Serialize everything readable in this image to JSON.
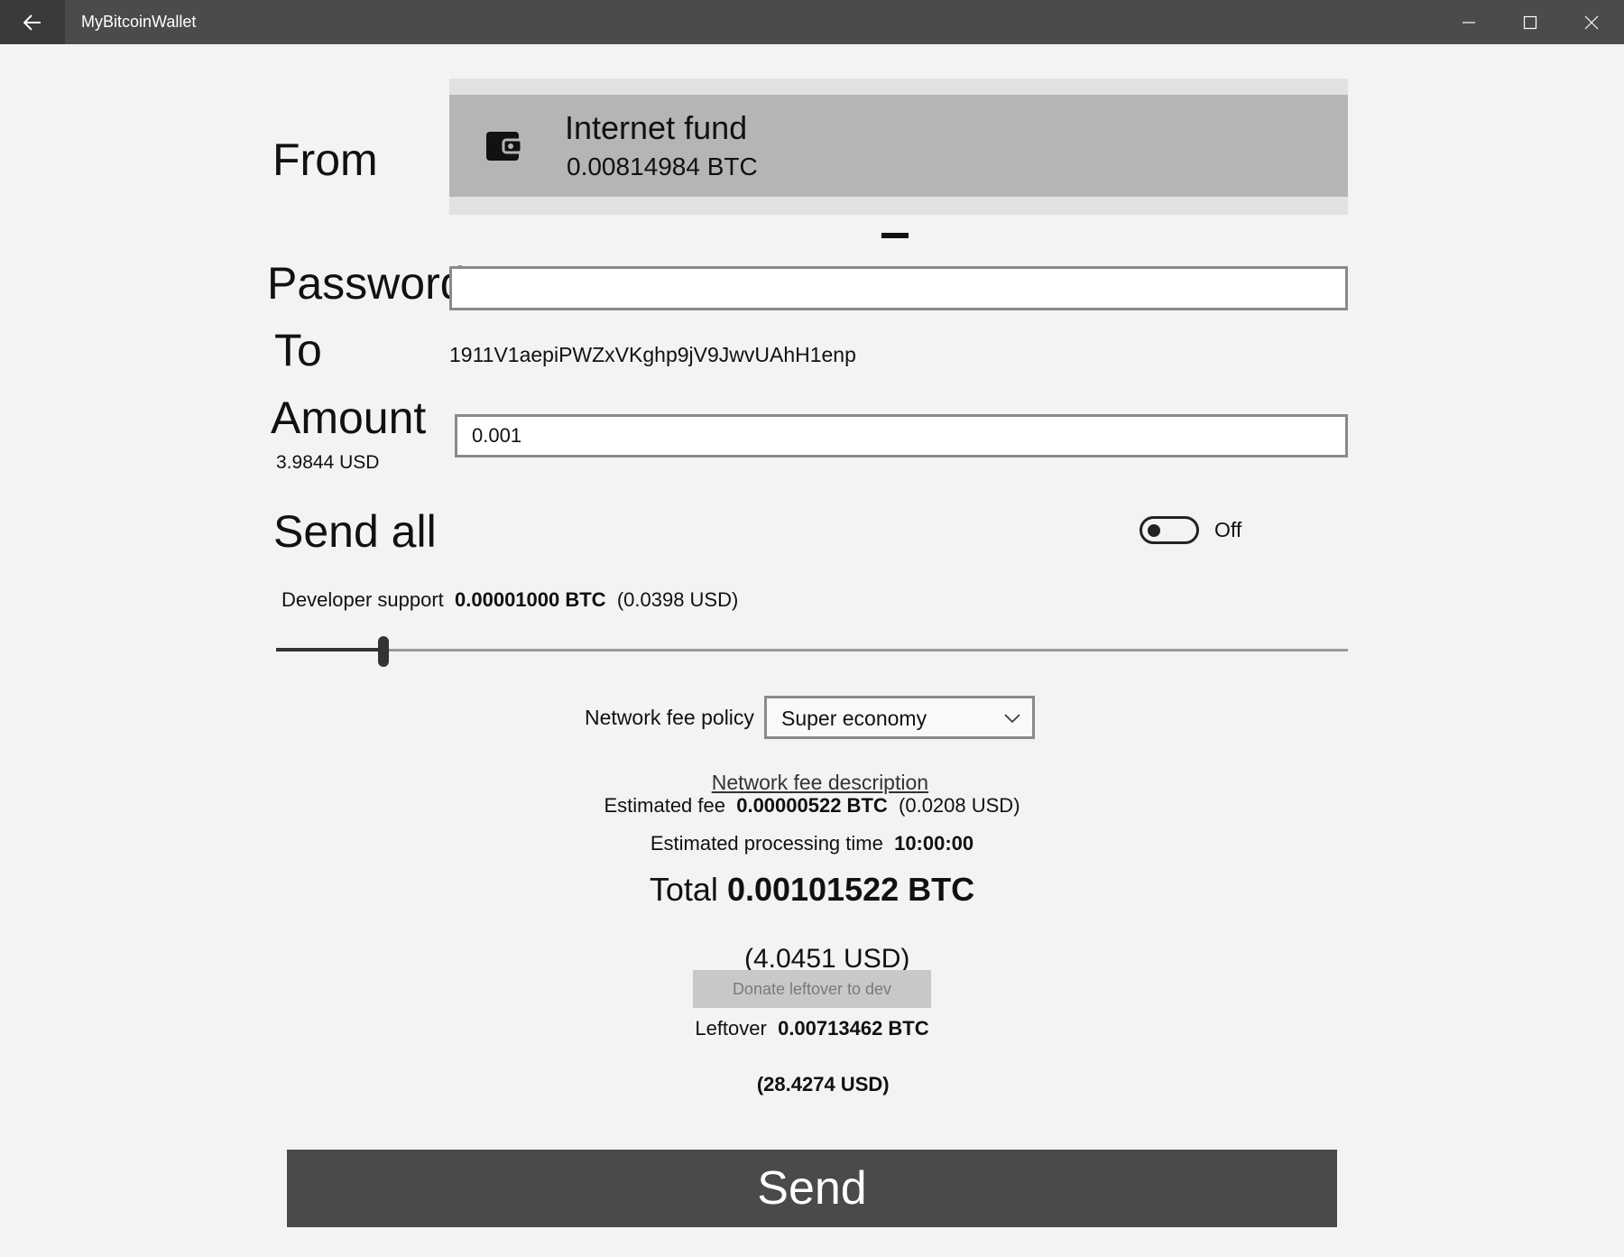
{
  "app": {
    "title": "MyBitcoinWallet"
  },
  "labels": {
    "from": "From",
    "password": "Password",
    "to": "To",
    "amount": "Amount",
    "send_all": "Send all"
  },
  "from_account": {
    "name": "Internet fund",
    "balance": "0.00814984 BTC",
    "icon": "wallet-icon"
  },
  "password": {
    "value": "",
    "placeholder": ""
  },
  "to_address": "1911V1aepiPWZxVKghp9jV9JwvUAhH1enp",
  "amount": {
    "value": "0.001",
    "usd": "3.9844 USD"
  },
  "send_all_toggle": {
    "state": "Off",
    "on": false
  },
  "developer_support": {
    "label": "Developer support",
    "btc": "0.00001000 BTC",
    "usd": "(0.0398 USD)",
    "slider_fraction": 0.1
  },
  "network_fee": {
    "label": "Network fee policy",
    "selected": "Super economy",
    "description_link": "Network fee description"
  },
  "estimated_fee": {
    "label": "Estimated fee",
    "btc": "0.00000522 BTC",
    "usd": "(0.0208 USD)"
  },
  "processing_time": {
    "label": "Estimated processing time",
    "value": "10:00:00"
  },
  "total": {
    "label": "Total",
    "btc": "0.00101522 BTC",
    "usd": "(4.0451 USD)"
  },
  "donate_button": "Donate leftover to dev",
  "leftover": {
    "label": "Leftover",
    "btc": "0.00713462 BTC",
    "usd": "(28.4274 USD)"
  },
  "send_button": "Send"
}
